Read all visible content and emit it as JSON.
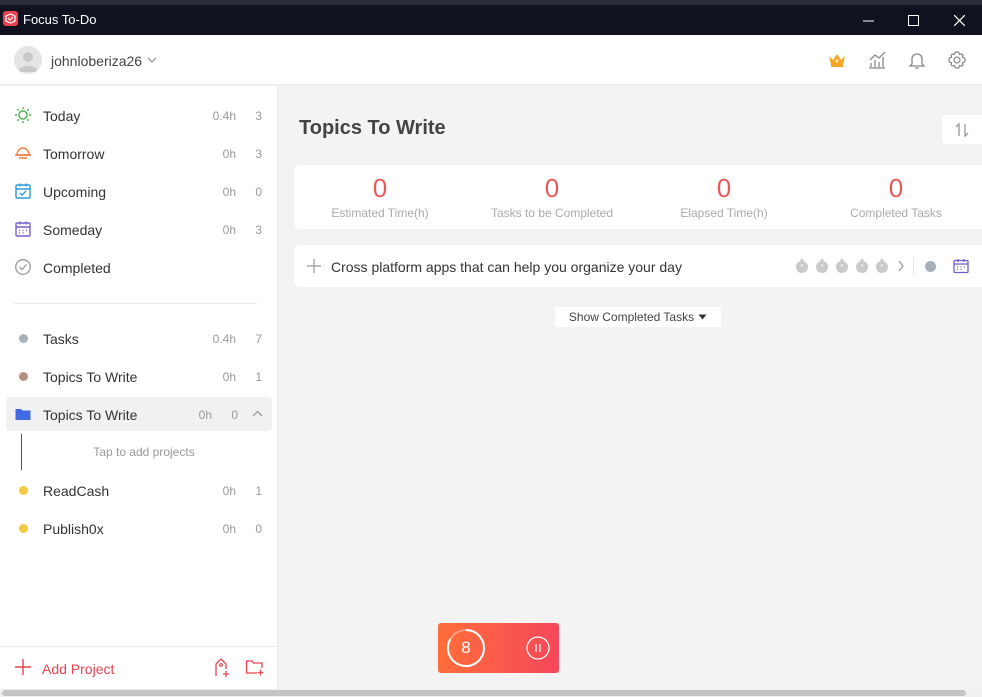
{
  "window": {
    "title": "Focus To-Do"
  },
  "user": {
    "name": "johnloberiza26"
  },
  "sidebar": {
    "filters": [
      {
        "label": "Today",
        "time": "0.4h",
        "count": "3",
        "icon": "sun-icon",
        "color": "#4caf50"
      },
      {
        "label": "Tomorrow",
        "time": "0h",
        "count": "3",
        "icon": "sunrise-icon",
        "color": "#f57c45"
      },
      {
        "label": "Upcoming",
        "time": "0h",
        "count": "0",
        "icon": "calendar-check-icon",
        "color": "#2e9bd6"
      },
      {
        "label": "Someday",
        "time": "0h",
        "count": "3",
        "icon": "calendar-icon",
        "color": "#7b5fd0"
      },
      {
        "label": "Completed",
        "time": "",
        "count": "",
        "icon": "check-circle-icon",
        "color": "#9a9a9a"
      }
    ],
    "projects": [
      {
        "label": "Tasks",
        "time": "0.4h",
        "count": "7",
        "color": "#a7b0b8"
      },
      {
        "label": "Topics To Write",
        "time": "0h",
        "count": "1",
        "color": "#b8907f"
      },
      {
        "label": "Topics To Write",
        "time": "0h",
        "count": "0",
        "color": "#4169e1"
      },
      {
        "label": "ReadCash",
        "time": "0h",
        "count": "1",
        "color": "#f5c842"
      },
      {
        "label": "Publish0x",
        "time": "0h",
        "count": "0",
        "color": "#f5c842"
      }
    ],
    "sub_hint": "Tap to add projects",
    "add_project": "Add Project"
  },
  "main": {
    "title": "Topics To Write",
    "stats": [
      {
        "value": "0",
        "label": "Estimated Time(h)"
      },
      {
        "value": "0",
        "label": "Tasks to be Completed"
      },
      {
        "value": "0",
        "label": "Elapsed Time(h)"
      },
      {
        "value": "0",
        "label": "Completed Tasks"
      }
    ],
    "task": {
      "text": "Cross platform apps that can help you organize your day",
      "pomodoros": 5
    },
    "show_completed": "Show Completed Tasks"
  },
  "timer": {
    "value": "8"
  },
  "colors": {
    "accent": "#e8434f",
    "stat_number": "#e85a5a"
  }
}
